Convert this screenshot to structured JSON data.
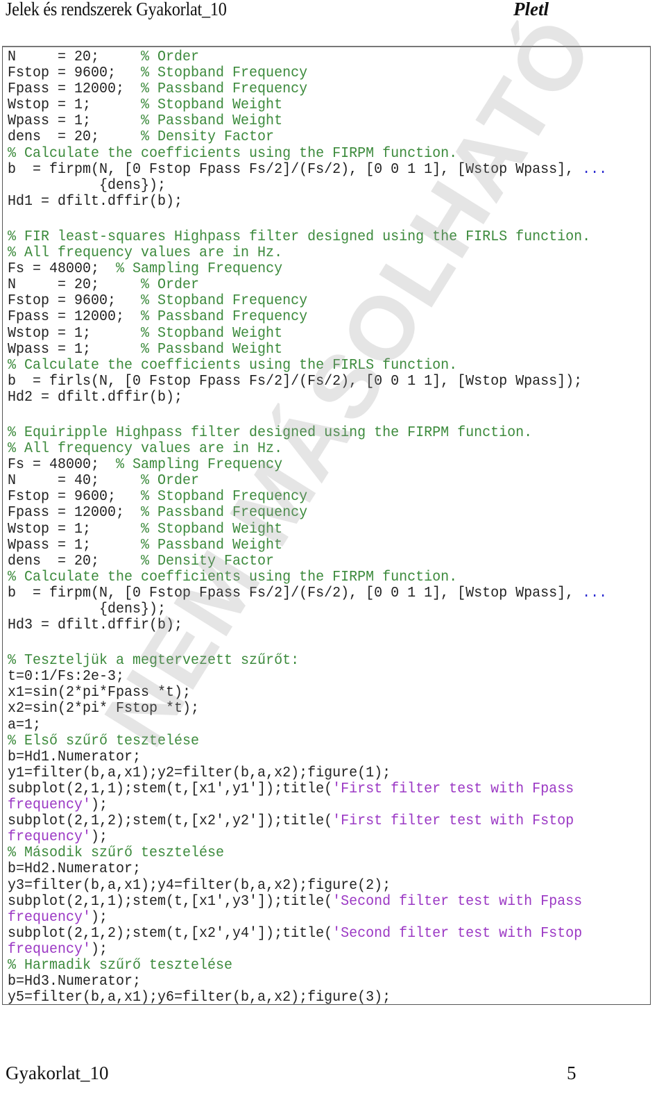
{
  "header": {
    "title": "Jelek és rendszerek Gyakorlat_10",
    "author": "Pletl"
  },
  "footer": {
    "left": "Gyakorlat_10",
    "page": "5"
  },
  "watermark": "NEM MÁSOLHATÓ",
  "colors": {
    "code": "#222222",
    "comment": "#3c8a3c",
    "string": "#9b38c4",
    "continuation": "#2a2ad0"
  },
  "code": {
    "lines": [
      [
        [
          "code",
          "N     = 20;     "
        ],
        [
          "comment",
          "% Order"
        ]
      ],
      [
        [
          "code",
          "Fstop = 9600;   "
        ],
        [
          "comment",
          "% Stopband Frequency"
        ]
      ],
      [
        [
          "code",
          "Fpass = 12000;  "
        ],
        [
          "comment",
          "% Passband Frequency"
        ]
      ],
      [
        [
          "code",
          "Wstop = 1;      "
        ],
        [
          "comment",
          "% Stopband Weight"
        ]
      ],
      [
        [
          "code",
          "Wpass = 1;      "
        ],
        [
          "comment",
          "% Passband Weight"
        ]
      ],
      [
        [
          "code",
          "dens  = 20;     "
        ],
        [
          "comment",
          "% Density Factor"
        ]
      ],
      [
        [
          "comment",
          "% Calculate the coefficients using the FIRPM function."
        ]
      ],
      [
        [
          "code",
          "b  = firpm(N, [0 Fstop Fpass Fs/2]/(Fs/2), [0 0 1 1], [Wstop Wpass], "
        ],
        [
          "cont",
          "..."
        ]
      ],
      [
        [
          "code",
          "           {dens});"
        ]
      ],
      [
        [
          "code",
          "Hd1 = dfilt.dffir(b);"
        ]
      ],
      [],
      [
        [
          "comment",
          "% FIR least-squares Highpass filter designed using the FIRLS function."
        ]
      ],
      [
        [
          "comment",
          "% All frequency values are in Hz."
        ]
      ],
      [
        [
          "code",
          "Fs = 48000;  "
        ],
        [
          "comment",
          "% Sampling Frequency"
        ]
      ],
      [
        [
          "code",
          "N     = 20;     "
        ],
        [
          "comment",
          "% Order"
        ]
      ],
      [
        [
          "code",
          "Fstop = 9600;   "
        ],
        [
          "comment",
          "% Stopband Frequency"
        ]
      ],
      [
        [
          "code",
          "Fpass = 12000;  "
        ],
        [
          "comment",
          "% Passband Frequency"
        ]
      ],
      [
        [
          "code",
          "Wstop = 1;      "
        ],
        [
          "comment",
          "% Stopband Weight"
        ]
      ],
      [
        [
          "code",
          "Wpass = 1;      "
        ],
        [
          "comment",
          "% Passband Weight"
        ]
      ],
      [
        [
          "comment",
          "% Calculate the coefficients using the FIRLS function."
        ]
      ],
      [
        [
          "code",
          "b  = firls(N, [0 Fstop Fpass Fs/2]/(Fs/2), [0 0 1 1], [Wstop Wpass]);"
        ]
      ],
      [
        [
          "code",
          "Hd2 = dfilt.dffir(b);"
        ]
      ],
      [],
      [
        [
          "comment",
          "% Equiripple Highpass filter designed using the FIRPM function."
        ]
      ],
      [
        [
          "comment",
          "% All frequency values are in Hz."
        ]
      ],
      [
        [
          "code",
          "Fs = 48000;  "
        ],
        [
          "comment",
          "% Sampling Frequency"
        ]
      ],
      [
        [
          "code",
          "N     = 40;     "
        ],
        [
          "comment",
          "% Order"
        ]
      ],
      [
        [
          "code",
          "Fstop = 9600;   "
        ],
        [
          "comment",
          "% Stopband Frequency"
        ]
      ],
      [
        [
          "code",
          "Fpass = 12000;  "
        ],
        [
          "comment",
          "% Passband Frequency"
        ]
      ],
      [
        [
          "code",
          "Wstop = 1;      "
        ],
        [
          "comment",
          "% Stopband Weight"
        ]
      ],
      [
        [
          "code",
          "Wpass = 1;      "
        ],
        [
          "comment",
          "% Passband Weight"
        ]
      ],
      [
        [
          "code",
          "dens  = 20;     "
        ],
        [
          "comment",
          "% Density Factor"
        ]
      ],
      [
        [
          "comment",
          "% Calculate the coefficients using the FIRPM function."
        ]
      ],
      [
        [
          "code",
          "b  = firpm(N, [0 Fstop Fpass Fs/2]/(Fs/2), [0 0 1 1], [Wstop Wpass], "
        ],
        [
          "cont",
          "..."
        ]
      ],
      [
        [
          "code",
          "           {dens});"
        ]
      ],
      [
        [
          "code",
          "Hd3 = dfilt.dffir(b);"
        ]
      ],
      [],
      [
        [
          "comment",
          "% Teszteljük a megtervezett szűrőt:"
        ]
      ],
      [
        [
          "code",
          "t=0:1/Fs:2e-3;"
        ]
      ],
      [
        [
          "code",
          "x1=sin(2*pi*Fpass *t);"
        ]
      ],
      [
        [
          "code",
          "x2=sin(2*pi* Fstop *t);"
        ]
      ],
      [
        [
          "code",
          "a=1;"
        ]
      ],
      [
        [
          "comment",
          "% Első szűrő tesztelése"
        ]
      ],
      [
        [
          "code",
          "b=Hd1.Numerator;"
        ]
      ],
      [
        [
          "code",
          "y1=filter(b,a,x1);y2=filter(b,a,x2);figure(1);"
        ]
      ],
      [
        [
          "code",
          "subplot(2,1,1);stem(t,[x1',y1']);title("
        ],
        [
          "string",
          "'First filter test with Fpass"
        ]
      ],
      [
        [
          "string",
          "frequency'"
        ],
        [
          "code",
          ");"
        ]
      ],
      [
        [
          "code",
          "subplot(2,1,2);stem(t,[x2',y2']);title("
        ],
        [
          "string",
          "'First filter test with Fstop"
        ]
      ],
      [
        [
          "string",
          "frequency'"
        ],
        [
          "code",
          ");"
        ]
      ],
      [
        [
          "comment",
          "% Második szűrő tesztelése"
        ]
      ],
      [
        [
          "code",
          "b=Hd2.Numerator;"
        ]
      ],
      [
        [
          "code",
          "y3=filter(b,a,x1);y4=filter(b,a,x2);figure(2);"
        ]
      ],
      [
        [
          "code",
          "subplot(2,1,1);stem(t,[x1',y3']);title("
        ],
        [
          "string",
          "'Second filter test with Fpass"
        ]
      ],
      [
        [
          "string",
          "frequency'"
        ],
        [
          "code",
          ");"
        ]
      ],
      [
        [
          "code",
          "subplot(2,1,2);stem(t,[x2',y4']);title("
        ],
        [
          "string",
          "'Second filter test with Fstop"
        ]
      ],
      [
        [
          "string",
          "frequency'"
        ],
        [
          "code",
          ");"
        ]
      ],
      [
        [
          "comment",
          "% Harmadik szűrő tesztelése"
        ]
      ],
      [
        [
          "code",
          "b=Hd3.Numerator;"
        ]
      ],
      [
        [
          "code",
          "y5=filter(b,a,x1);y6=filter(b,a,x2);figure(3);"
        ]
      ]
    ]
  }
}
